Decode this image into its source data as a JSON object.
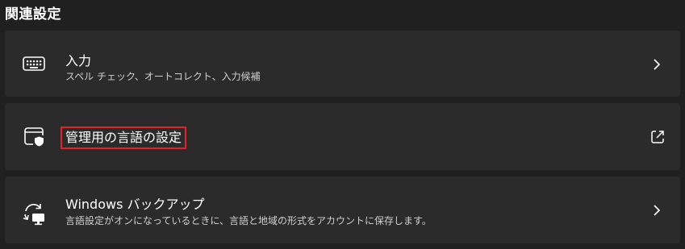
{
  "section": {
    "title": "関連設定"
  },
  "items": [
    {
      "title": "入力",
      "subtitle": "スペル チェック、オートコレクト、入力候補",
      "icon": "keyboard-icon",
      "action_icon": "chevron-right-icon"
    },
    {
      "title": "管理用の言語の設定",
      "icon": "admin-shield-window-icon",
      "action_icon": "external-link-icon",
      "highlight_color": "#e8202a"
    },
    {
      "title": "Windows バックアップ",
      "subtitle": "言語設定がオンになっているときに、言語と地域の形式をアカウントに保存します。",
      "icon": "backup-sync-icon",
      "action_icon": "chevron-right-icon"
    }
  ],
  "colors": {
    "background": "#202020",
    "card": "#2b2b2b",
    "text": "#ffffff",
    "subtext": "#cfcfcf"
  }
}
